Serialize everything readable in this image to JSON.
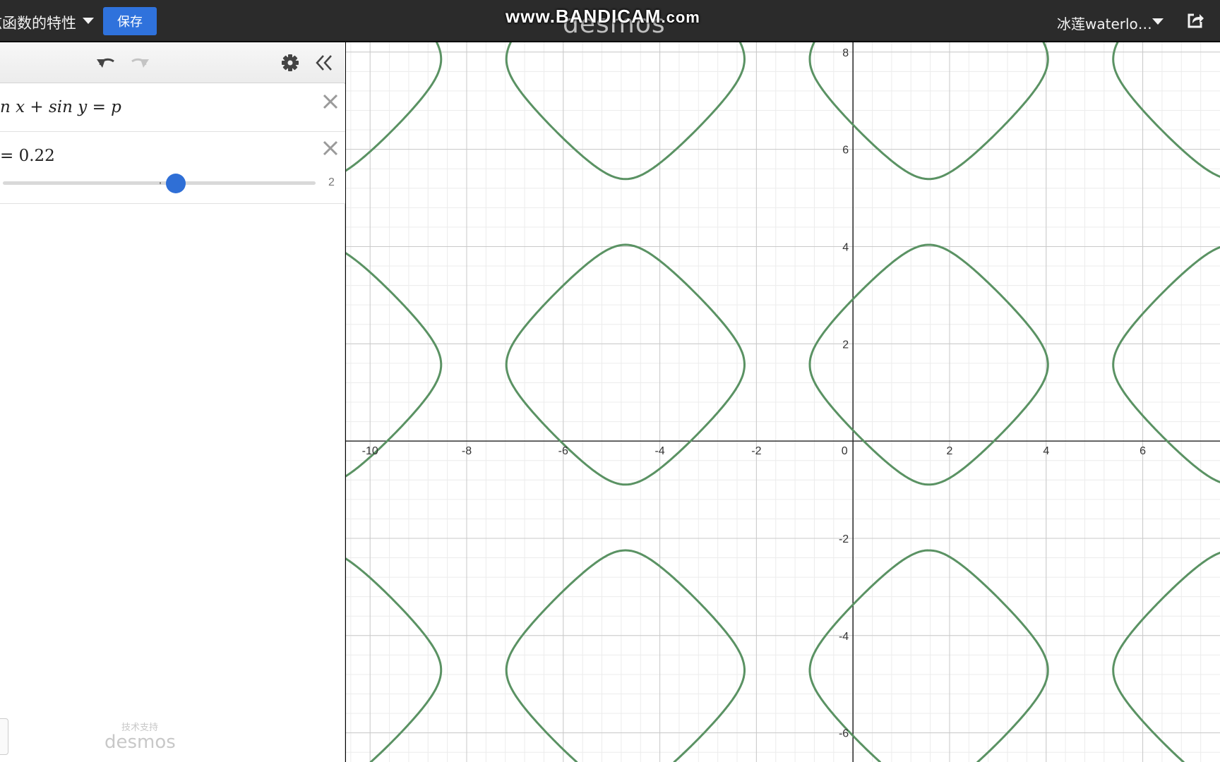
{
  "topbar": {
    "graph_title": "弦函数的特性",
    "save_label": "保存",
    "logo_text": "desmos",
    "watermark_main": "www.BANDICAM",
    "watermark_suffix": ".com",
    "user_name": "冰莲waterlo…"
  },
  "panel": {
    "expressions": [
      {
        "latex_text": "n x + sin y = p"
      },
      {
        "text": "= 0.22",
        "slider_max": "2",
        "slider_value_fraction": 0.555
      }
    ],
    "powered_by_caption": "技术支持",
    "powered_by_logo": "desmos"
  },
  "graph": {
    "x_range": [
      -10.5,
      7.6
    ],
    "y_range": [
      -6.6,
      8.2
    ],
    "curve_color": "#5a9263",
    "equation": "sin x + sin y = p",
    "p": 0.22,
    "x_ticks": [
      "-10",
      "-8",
      "-6",
      "-4",
      "-2",
      "0",
      "2",
      "4",
      "6"
    ],
    "y_ticks": [
      "8",
      "6",
      "4",
      "2",
      "-2",
      "-4",
      "-6"
    ]
  }
}
